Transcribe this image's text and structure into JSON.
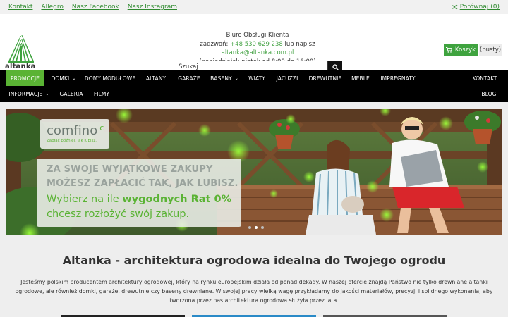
{
  "topbar": {
    "links": [
      "Kontakt",
      "Allegro",
      "Nasz Facebook",
      "Nasz Instagram"
    ],
    "compare_label": "Porównaj (0)"
  },
  "header": {
    "logo_text": "altanka",
    "service_title": "Biuro Obsługi Klienta",
    "service_call_prefix": "zadzwoń:",
    "service_phone": "+48 530 629 238",
    "service_or": "lub napisz",
    "service_email": "altanka@altanka.com.pl",
    "service_hours": "(poniedziałek-piątek od 8:00 do 16:00)",
    "search_placeholder": "Szukaj",
    "cart_label": "Koszyk",
    "cart_status": "(pusty)"
  },
  "nav": {
    "row1": [
      "PROMOCJE",
      "DOMKI",
      "DOMY MODUŁOWE",
      "ALTANY",
      "GARAŻE",
      "BASENY",
      "WIATY",
      "JACUZZI",
      "DREWUTNIE",
      "MEBLE",
      "IMPREGNATY",
      "KONTAKT"
    ],
    "row2": [
      "INFORMACJE",
      "GALERIA",
      "FILMY",
      "BLOG"
    ]
  },
  "banner": {
    "brand": "comfino",
    "brand_tagline": "Zapłać później. Jak lubisz.",
    "headline_line1": "ZA SWOJE WYJĄTKOWE ZAKUPY",
    "headline_line2": "MOŻESZ ZAPŁACIĆ TAK, JAK LUBISZ.",
    "offer_line1_prefix": "Wybierz na ile ",
    "offer_line1_bold": "wygodnych Rat 0%",
    "offer_line2": "chcesz rozłożyć swój zakup."
  },
  "content": {
    "heading": "Altanka - architektura ogrodowa idealna do Twojego ogrodu",
    "paragraph": "Jesteśmy polskim producentem architektury ogrodowej, który na rynku europejskim działa od ponad dekady. W naszej ofercie znajdą Państwo nie tylko drewniane altanki ogrodowe, ale również domki, garaże, drewutnie czy baseny drewniane. W swojej pracy wielką wagę przykładamy do jakości materiałów, precyzji i solidnego wykonania, aby tworzona przez nas architektura ogrodowa służyła przez lata."
  },
  "colors": {
    "accent_green": "#5ab334",
    "link_green": "#2f8a2f",
    "nav_bg": "#000000"
  }
}
